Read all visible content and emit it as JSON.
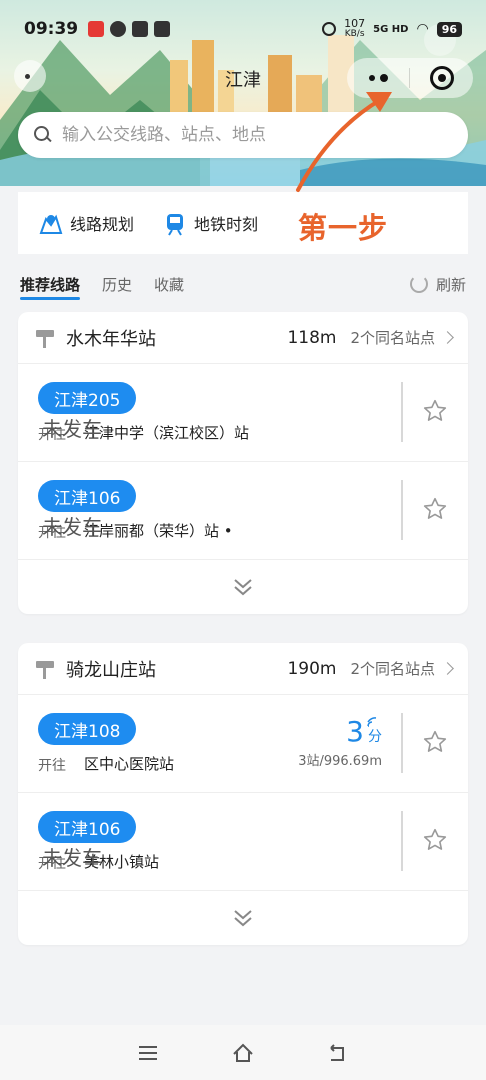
{
  "status_bar": {
    "time": "09:39",
    "net_speed": "107",
    "net_unit": "KB/s",
    "battery": "96"
  },
  "nav": {
    "title": "江津"
  },
  "search": {
    "placeholder": "输入公交线路、站点、地点"
  },
  "tools": [
    {
      "label": "线路规划",
      "icon": "route-plan-icon"
    },
    {
      "label": "地铁时刻",
      "icon": "metro-icon"
    }
  ],
  "annotation": {
    "step_text": "第一步",
    "color": "#e8642c"
  },
  "tabs": {
    "items": [
      "推荐线路",
      "历史",
      "收藏"
    ],
    "active": "推荐线路",
    "refresh_label": "刷新"
  },
  "cards": [
    {
      "station": "水木年华站",
      "distance": "118m",
      "same_name": "2个同名站点",
      "routes": [
        {
          "line": "江津205",
          "dir_label": "开往",
          "dest": "江津中学（滨江校区）站",
          "status": "未发车"
        },
        {
          "line": "江津106",
          "dir_label": "开往",
          "dest": "江岸丽都（荣华）站 •",
          "status": "未发车"
        }
      ]
    },
    {
      "station": "骑龙山庄站",
      "distance": "190m",
      "same_name": "2个同名站点",
      "routes": [
        {
          "line": "江津108",
          "dir_label": "开往",
          "dest": "区中心医院站",
          "eta_num": "3",
          "eta_unit": "分",
          "eta_sub": "3站/996.69m"
        },
        {
          "line": "江津106",
          "dir_label": "开往",
          "dest": "美林小镇站",
          "status": "未发车"
        }
      ]
    }
  ],
  "colors": {
    "accent": "#1e88e5",
    "badge": "#1e8cf0"
  }
}
